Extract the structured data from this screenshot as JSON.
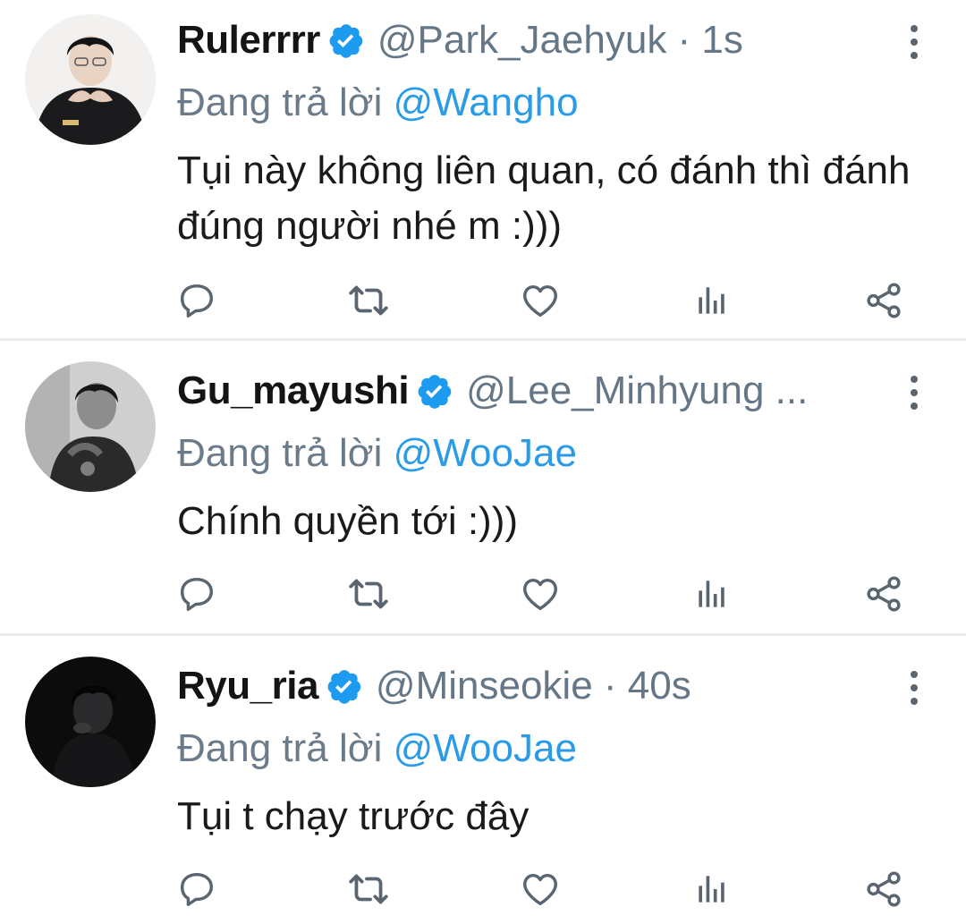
{
  "colors": {
    "verified_blue": "#1d9bf0",
    "mention_blue": "#2a9be7",
    "muted_gray": "#657786",
    "icon_gray": "#5a6570"
  },
  "tweets": [
    {
      "name": "Rulerrrr",
      "handle": "@Park_Jaehyuk · 1s",
      "reply_prefix": "Đang trả lời",
      "reply_to": "@Wangho",
      "text": "Tụi này không liên quan, có đánh thì đánh đúng người nhé m :)))",
      "icons": [
        "reply-icon",
        "retweet-icon",
        "like-icon",
        "analytics-icon",
        "share-icon"
      ]
    },
    {
      "name": "Gu_mayushi",
      "handle": "@Lee_Minhyung ...",
      "reply_prefix": "Đang trả lời",
      "reply_to": "@WooJae",
      "text": "Chính quyền tới :)))",
      "icons": [
        "reply-icon",
        "retweet-icon",
        "like-icon",
        "analytics-icon",
        "share-icon"
      ]
    },
    {
      "name": "Ryu_ria",
      "handle": "@Minseokie · 40s",
      "reply_prefix": "Đang trả lời",
      "reply_to": "@WooJae",
      "text": "Tụi t chạy trước đây",
      "icons": [
        "reply-icon",
        "retweet-icon",
        "like-icon",
        "analytics-icon",
        "share-icon"
      ]
    }
  ]
}
